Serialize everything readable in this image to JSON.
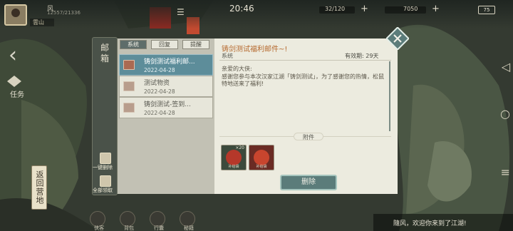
{
  "topbar": {
    "player_name": "风",
    "player_id": "12557/21336",
    "location": "雲山",
    "clock": "20:46",
    "resource_1": "32/120",
    "resource_2": "7050",
    "battery": "75"
  },
  "left": {
    "task_label": "任务",
    "return_label": "返回营地"
  },
  "bottom_nav": [
    "侠客",
    "背包",
    "行囊",
    "秘籍"
  ],
  "chat": {
    "message": "隨风，欢迎你来到了江湖!"
  },
  "mail": {
    "title": "邮箱",
    "tabs": [
      "系统",
      "回复",
      "提醒"
    ],
    "side_actions": {
      "delete_all": "一键删除",
      "claim_all": "全部领取"
    },
    "items": [
      {
        "title": "铸剑测试福利邮...",
        "date": "2022-04-28",
        "selected": true
      },
      {
        "title": "测试物资",
        "date": "2022-04-28",
        "selected": false
      },
      {
        "title": "铸剑测试-签到...",
        "date": "2022-04-28",
        "selected": false
      }
    ],
    "detail": {
      "title": "铸剑测试福利邮件~!",
      "sender": "系统",
      "expiry": "有效期: 29天",
      "greeting": "亲爱的大侠:",
      "body": "感谢您参与本次汉家江湖「铸剑测试」，为了感谢您的热情，松鼠特地送来了福利!",
      "attachments_label": "附件",
      "attachments": [
        {
          "name": "补给袋",
          "count": "×20"
        },
        {
          "name": "补给袋",
          "count": ""
        }
      ],
      "delete_label": "删除"
    }
  },
  "colors": {
    "accent": "#5b7c7a",
    "selected": "#5d8d9a",
    "title": "#b66a2f"
  }
}
